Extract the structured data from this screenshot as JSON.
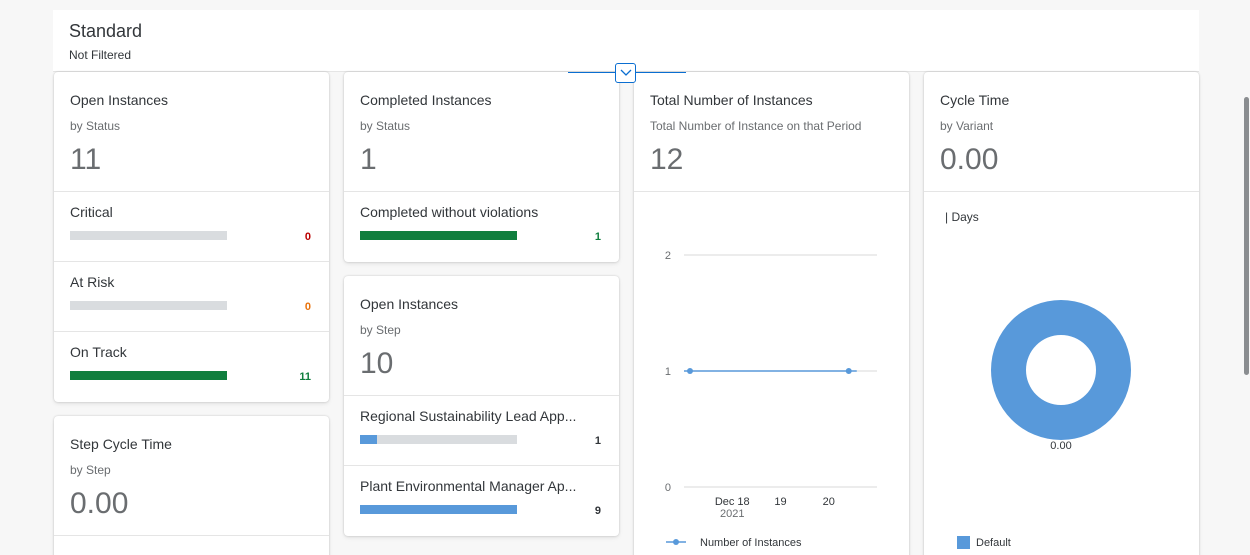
{
  "header": {
    "title": "Standard",
    "subtitle": "Not Filtered"
  },
  "cards": {
    "open_instances": {
      "title": "Open Instances",
      "subtitle": "by Status",
      "kpi": "11",
      "items": [
        {
          "label": "Critical",
          "value": "0",
          "fraction": 0,
          "color": "#bb0000"
        },
        {
          "label": "At Risk",
          "value": "0",
          "fraction": 0,
          "color": "#e9730c"
        },
        {
          "label": "On Track",
          "value": "11",
          "fraction": 1,
          "color": "#107e3e"
        }
      ]
    },
    "completed_instances": {
      "title": "Completed Instances",
      "subtitle": "by Status",
      "kpi": "1",
      "items": [
        {
          "label": "Completed without violations",
          "value": "1",
          "fraction": 1,
          "color": "#107e3e"
        }
      ]
    },
    "open_instances_step": {
      "title": "Open Instances",
      "subtitle": "by Step",
      "kpi": "10",
      "items": [
        {
          "label": "Regional Sustainability Lead App...",
          "value": "1",
          "fraction": 0.11,
          "color": "#5899da"
        },
        {
          "label": "Plant Environmental Manager Ap...",
          "value": "9",
          "fraction": 1,
          "color": "#5899da"
        }
      ]
    },
    "step_cycle_time": {
      "title": "Step Cycle Time",
      "subtitle": "by Step",
      "kpi": "0.00"
    },
    "total_instances": {
      "title": "Total Number of Instances",
      "subtitle": "Total Number of Instance on that Period",
      "kpi": "12"
    },
    "cycle_time": {
      "title": "Cycle Time",
      "subtitle": "by Variant",
      "kpi": "0.00",
      "unit_label": "| Days",
      "donut_value_label": "0.00",
      "legend": "Default"
    }
  },
  "chart_data": [
    {
      "type": "line",
      "x": [
        "2021-12-17",
        "2021-12-20"
      ],
      "y_ticks": [
        "0",
        "1",
        "2"
      ],
      "x_tick_labels": [
        "Dec 18",
        "19",
        "20"
      ],
      "x_tick_sublabel": "2021",
      "ylim": [
        0,
        2
      ],
      "series": [
        {
          "name": "Number of Instances",
          "values": [
            1,
            1
          ],
          "color": "#5899da"
        }
      ],
      "legend_position": "bottom-left",
      "grid": true
    },
    {
      "type": "pie",
      "donut": true,
      "categories": [
        "Default"
      ],
      "values": [
        0.0
      ],
      "data_label": "0.00",
      "color": "#5899da",
      "legend_position": "bottom-left"
    }
  ]
}
